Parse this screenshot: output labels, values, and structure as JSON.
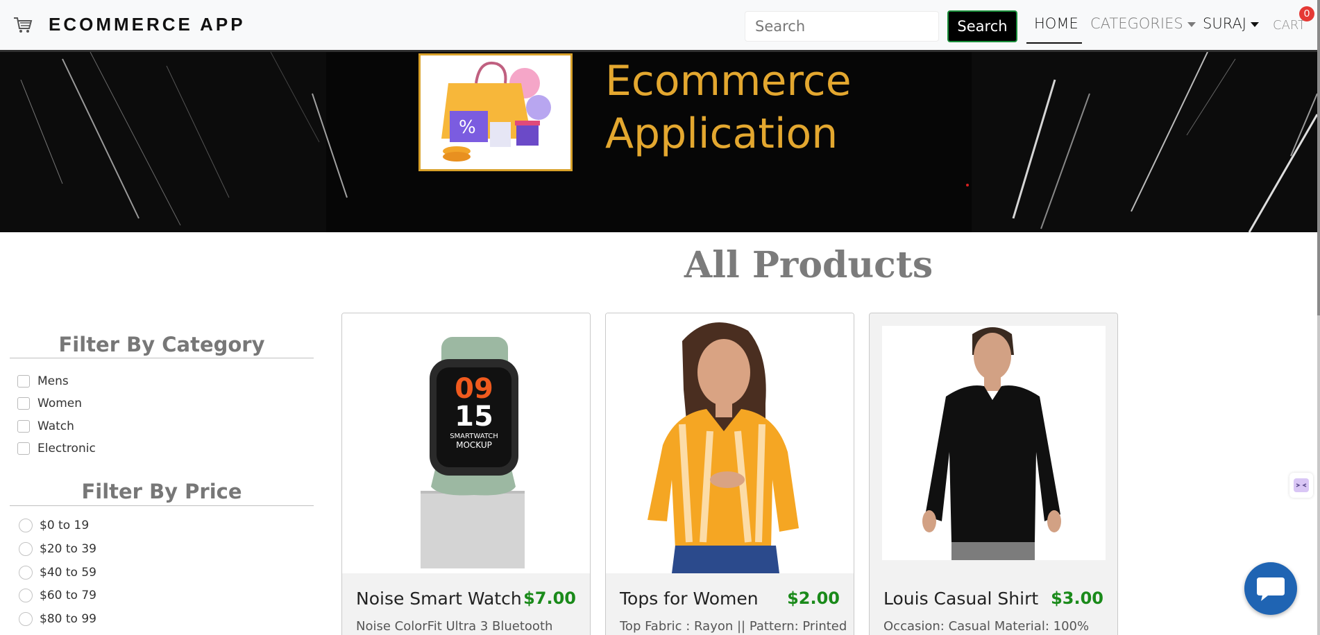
{
  "navbar": {
    "brand": "ECOMMERCE APP",
    "search_placeholder": "Search",
    "search_button": "Search",
    "links": {
      "home": "HOME",
      "categories": "CATEGORIES",
      "user": "SURAJ",
      "cart": "CART"
    },
    "cart_count": "0",
    "brand_icon": "shopping-cart-icon"
  },
  "banner": {
    "title_line1": "Ecommerce",
    "title_line2": "Application"
  },
  "main": {
    "title": "All Products"
  },
  "filters": {
    "category_heading": "Filter By Category",
    "categories": [
      "Mens",
      "Women",
      "Watch",
      "Electronic"
    ],
    "price_heading": "Filter By Price",
    "prices": [
      "$0 to 19",
      "$20 to 39",
      "$40 to 59",
      "$60 to 79",
      "$80 to 99"
    ]
  },
  "products": [
    {
      "name": "Noise Smart Watch",
      "price": "$7.00",
      "description": "Noise ColorFit Ultra 3 Bluetooth",
      "watch_time": [
        "09",
        "15"
      ],
      "watch_caption": [
        "SMARTWATCH",
        "MOCKUP"
      ]
    },
    {
      "name": "Tops for Women",
      "price": "$2.00",
      "description": "Top Fabric : Rayon || Pattern: Printed"
    },
    {
      "name": "Louis Casual Shirt",
      "price": "$3.00",
      "description": "Occasion: Casual Material: 100%"
    }
  ],
  "colors": {
    "price_green": "#1a8a1a",
    "banner_gold": "#e3a72f",
    "chat_blue": "#1f64b3",
    "badge_red": "#e53935"
  }
}
